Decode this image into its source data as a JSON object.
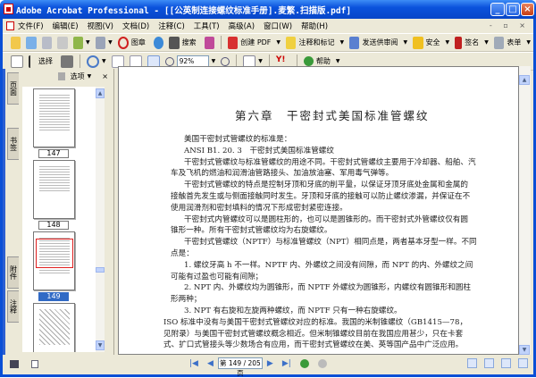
{
  "window": {
    "title": "Adobe Acrobat Professional - [[公英制连接螺纹标准手册].麦繁.扫描版.pdf]"
  },
  "menu": [
    "文件(F)",
    "编辑(E)",
    "视图(V)",
    "文档(D)",
    "注释(C)",
    "工具(T)",
    "高级(A)",
    "窗口(W)",
    "帮助(H)"
  ],
  "toolbar1": {
    "stamp": "图章",
    "search": "搜索",
    "create_pdf": "创建 PDF",
    "comment": "注释和标记",
    "review": "发送供审阅",
    "security": "安全",
    "sign": "签名",
    "forms": "表单"
  },
  "toolbar2": {
    "select": "选择",
    "zoom": "92%",
    "help": "帮助"
  },
  "sidebar": {
    "tabs": [
      "页面",
      "书签",
      "附件",
      "注释"
    ],
    "options": "选项",
    "thumbnails": [
      {
        "label": "147"
      },
      {
        "label": "148"
      },
      {
        "label": "149"
      }
    ]
  },
  "document": {
    "chapter_title": "第六章　干密封式美国标准管螺纹",
    "lines": [
      "美国干密封式管螺纹的标准是：",
      "ANSI B1. 20. 3　干密封式美国标准管螺纹",
      "干密封式管螺纹与标准管螺纹的用途不同。干密封式管螺纹主要用于冷却器、船舶、汽",
      "车及飞机的燃油和润滑油管路接头、加油放油塞、军用毒气弹等。",
      "干密封式管螺纹的特点是控制牙顶和牙底的削平量，以保证牙顶牙底处金属和金属的",
      "接触首先发生或与侧面接触同时发生。牙顶和牙底的接触可以防止螺纹渗漏，并保证在不",
      "使用润滑剂和密封填料的情况下形成密封紧密连接。",
      "干密封式内管螺纹可以是圆柱形的，也可以是圆锥形的。而干密封式外管螺纹仅有圆",
      "锥形一种。所有干密封式管螺纹均为右旋螺纹。",
      "干密封式管螺纹（NPTF）与标准管螺纹（NPT）相同点是，两者基本牙型一样。不同",
      "点是：",
      "1. 螺纹牙高 h 不一样。NPTF 内、外螺纹之间没有间隙，而 NPT 的内、外螺纹之间",
      "可能有过盈也可能有间隙；",
      "2. NPT 内、外螺纹均为圆锥形，而 NPTF 外螺纹为圆锥形，内螺纹有圆锥形和圆柱",
      "形两种；",
      "3. NPT 有右旋和左旋两种螺纹，而 NPTF 只有一种右旋螺纹。",
      "ISO 标准中没有与美国干密封式管螺纹对应的标准。我国的米制锥螺纹（GB1415—78，",
      "见附录）与美国干密封式管螺纹概念相近。但米制锥螺纹目前在我国应用甚少，只在卡套",
      "式、扩口式管接头等少数场合有应用，而干密封式管螺纹在美、英等国产品中广泛应用。"
    ]
  },
  "status": {
    "page": "第 149 / 205 页"
  }
}
